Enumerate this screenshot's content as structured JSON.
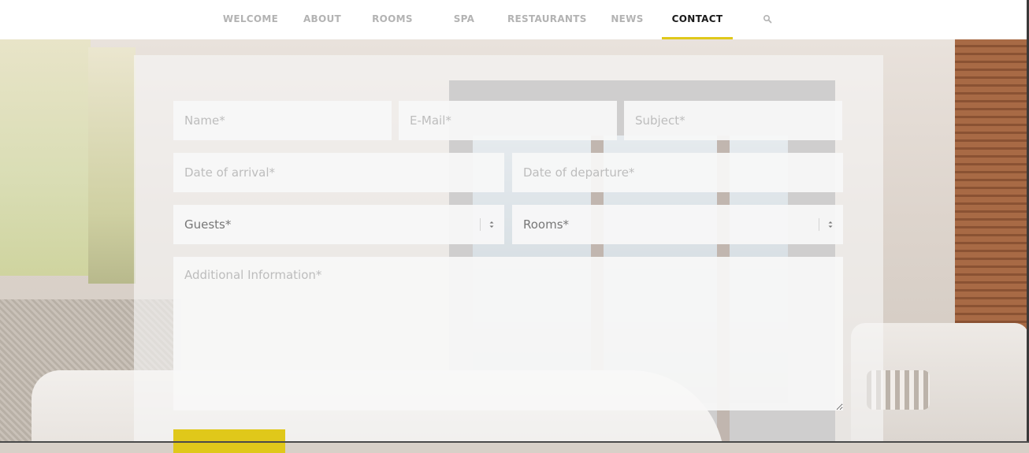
{
  "nav": {
    "items": [
      {
        "label": "WELCOME"
      },
      {
        "label": "ABOUT"
      },
      {
        "label": "ROOMS"
      },
      {
        "label": "SPA"
      },
      {
        "label": "RESTAURANTS"
      },
      {
        "label": "NEWS"
      },
      {
        "label": "CONTACT",
        "active": true
      }
    ],
    "search_icon": "search-icon",
    "active_color": "#e0c81a"
  },
  "form": {
    "name_placeholder": "Name*",
    "email_placeholder": "E-Mail*",
    "subject_placeholder": "Subject*",
    "arrival_placeholder": "Date of arrival*",
    "departure_placeholder": "Date of departure*",
    "guests_value": "Guests*",
    "rooms_value": "Rooms*",
    "info_placeholder": "Additional Information*",
    "submit_color": "#e0c81a"
  }
}
